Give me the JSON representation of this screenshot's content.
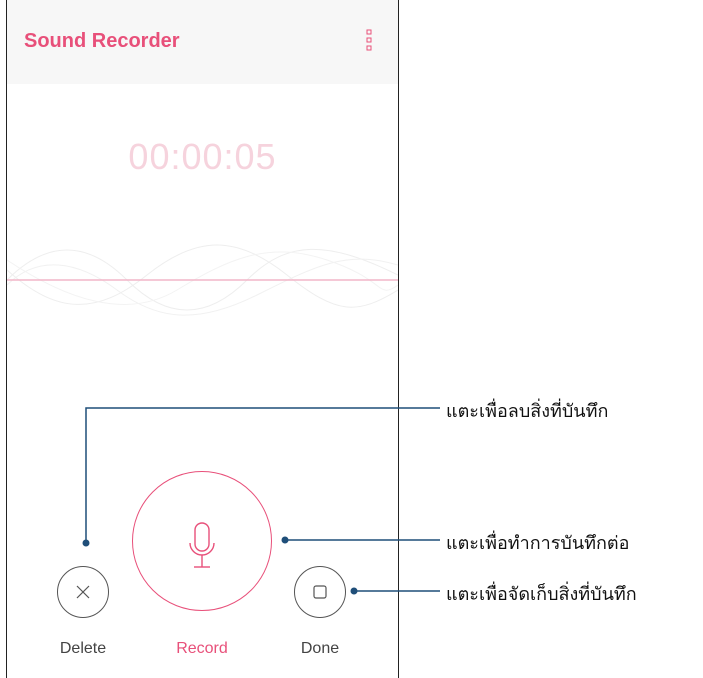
{
  "app": {
    "title": "Sound Recorder",
    "menu_icon": "more-vertical-icon"
  },
  "recording": {
    "elapsed_time": "00:00:05"
  },
  "controls": {
    "delete": {
      "label": "Delete",
      "icon": "close-icon"
    },
    "record": {
      "label": "Record",
      "icon": "microphone-icon"
    },
    "done": {
      "label": "Done",
      "icon": "stop-square-icon"
    }
  },
  "callouts": {
    "delete_note": "แตะเพื่อลบสิ่งที่บันทึก",
    "record_note": "แตะเพื่อทำการบันทึกต่อ",
    "done_note": "แตะเพื่อจัดเก็บสิ่งที่บันทึก"
  },
  "colors": {
    "accent": "#e8507a",
    "timer_faded": "#f6d3dd",
    "callout_line": "#1f4e79",
    "appbar_bg": "#f7f7f7"
  }
}
